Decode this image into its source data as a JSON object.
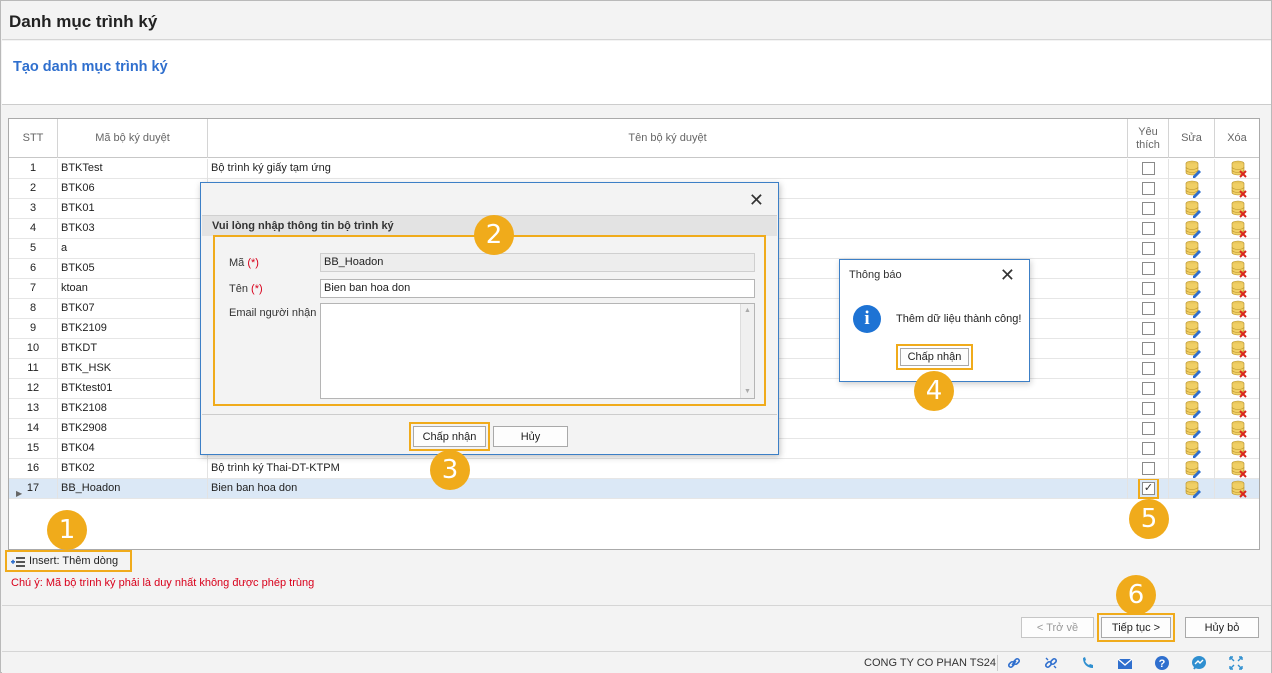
{
  "window": {
    "title": "Danh mục trình ký",
    "subtitle": "Tạo danh mục trình ký"
  },
  "grid": {
    "columns": [
      "STT",
      "Mã bộ ký duyệt",
      "Tên bộ ký duyệt",
      "Yêu thích",
      "Sửa",
      "Xóa"
    ],
    "rows": [
      {
        "stt": "1",
        "code": "BTKTest",
        "name": "Bộ trình ký giấy tạm ứng",
        "fav": false
      },
      {
        "stt": "2",
        "code": "BTK06",
        "name": "",
        "fav": false
      },
      {
        "stt": "3",
        "code": "BTK01",
        "name": "",
        "fav": false
      },
      {
        "stt": "4",
        "code": "BTK03",
        "name": "",
        "fav": false
      },
      {
        "stt": "5",
        "code": "a",
        "name": "",
        "fav": false
      },
      {
        "stt": "6",
        "code": "BTK05",
        "name": "",
        "fav": false
      },
      {
        "stt": "7",
        "code": "ktoan",
        "name": "",
        "fav": false
      },
      {
        "stt": "8",
        "code": "BTK07",
        "name": "",
        "fav": false
      },
      {
        "stt": "9",
        "code": "BTK2109",
        "name": "",
        "fav": false
      },
      {
        "stt": "10",
        "code": "BTKDT",
        "name": "",
        "fav": false
      },
      {
        "stt": "11",
        "code": "BTK_HSK",
        "name": "",
        "fav": false
      },
      {
        "stt": "12",
        "code": "BTKtest01",
        "name": "",
        "fav": false
      },
      {
        "stt": "13",
        "code": "BTK2108",
        "name": "",
        "fav": false
      },
      {
        "stt": "14",
        "code": "BTK2908",
        "name": "",
        "fav": false
      },
      {
        "stt": "15",
        "code": "BTK04",
        "name": "",
        "fav": false
      },
      {
        "stt": "16",
        "code": "BTK02",
        "name": "Bộ trình ký Thai-DT-KTPM",
        "fav": false
      },
      {
        "stt": "17",
        "code": "BB_Hoadon",
        "name": "Bien ban hoa don",
        "fav": true,
        "selected": true
      }
    ]
  },
  "insert_label": "Insert: Thêm dòng",
  "note": "Chú ý: Mã bộ trình ký phải là duy nhất không được phép trùng",
  "footer": {
    "back": "< Trở về",
    "next": "Tiếp tục >",
    "cancel": "Hủy bỏ"
  },
  "status": {
    "company": "CONG TY CO PHAN TS24"
  },
  "dialog": {
    "header": "Vui lòng nhập thông tin bộ trình ký",
    "code_label": "Mã",
    "code_value": "BB_Hoadon",
    "name_label": "Tên",
    "name_value": "Bien ban hoa don",
    "email_label": "Email người nhận",
    "required_mark": "(*)",
    "ok": "Chấp nhận",
    "cancel": "Hủy"
  },
  "message": {
    "title": "Thông báo",
    "text": "Thêm dữ liệu thành công!",
    "ok": "Chấp nhận"
  },
  "steps": [
    "1",
    "2",
    "3",
    "4",
    "5",
    "6"
  ],
  "colors": {
    "accent": "#f0ab1b",
    "title_blue": "#2f6fce",
    "warning": "#d9001b",
    "selected_row": "#dbe8f6"
  }
}
